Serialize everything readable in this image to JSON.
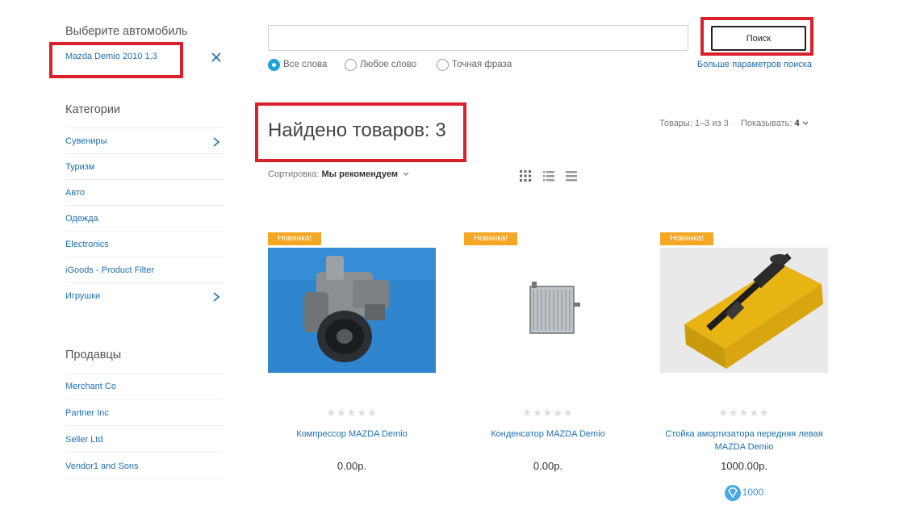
{
  "sidebar": {
    "choose_car_heading": "Выберите автомобиль",
    "selected_car": "Mazda Demio 2010 1,3",
    "categories_heading": "Категории",
    "categories": [
      {
        "label": "Сувениры",
        "has_children": true
      },
      {
        "label": "Туризм",
        "has_children": false
      },
      {
        "label": "Авто",
        "has_children": false
      },
      {
        "label": "Одежда",
        "has_children": false
      },
      {
        "label": "Electronics",
        "has_children": false
      },
      {
        "label": "iGoods - Product Filter",
        "has_children": false
      },
      {
        "label": "Игрушки",
        "has_children": true
      }
    ],
    "vendors_heading": "Продавцы",
    "vendors": [
      {
        "label": "Merchant Co"
      },
      {
        "label": "Partner Inc"
      },
      {
        "label": "Seller Ltd"
      },
      {
        "label": "Vendor1 and Sons"
      }
    ]
  },
  "search": {
    "value": "",
    "button_label": "Поиск",
    "options": [
      {
        "label": "Все слова",
        "selected": true
      },
      {
        "label": "Любое слово",
        "selected": false
      },
      {
        "label": "Точная фраза",
        "selected": false
      }
    ],
    "more_params": "Больше параметров поиска"
  },
  "results": {
    "found_title": "Найдено товаров: 3",
    "range_text": "Товары: 1–3 из 3",
    "show_label": "Показывать:",
    "show_value": "4",
    "sort_label": "Сортировка:",
    "sort_value": "Мы рекомендуем",
    "view_modes": [
      "grid-view-icon",
      "list-view-icon",
      "compact-list-icon"
    ]
  },
  "products": [
    {
      "badge": "Новинка!",
      "name": "Компрессор MAZDA Demio",
      "price": "0.00р.",
      "rating": 0,
      "points": null,
      "image": "compressor-photo"
    },
    {
      "badge": "Новинка!",
      "name": "Конденсатор MAZDA Demio",
      "price": "0.00р.",
      "rating": 0,
      "points": null,
      "image": "condenser-photo"
    },
    {
      "badge": "Новинка!",
      "name": "Стойка амортизатора передняя левая MAZDA Demio",
      "price": "1000.00р.",
      "rating": 0,
      "points": "1000",
      "image": "shock-absorber-photo"
    }
  ],
  "colors": {
    "link": "#1f6fb0",
    "accent": "#1ea5d8",
    "badge": "#f5a623",
    "highlight": "#d9212c"
  }
}
